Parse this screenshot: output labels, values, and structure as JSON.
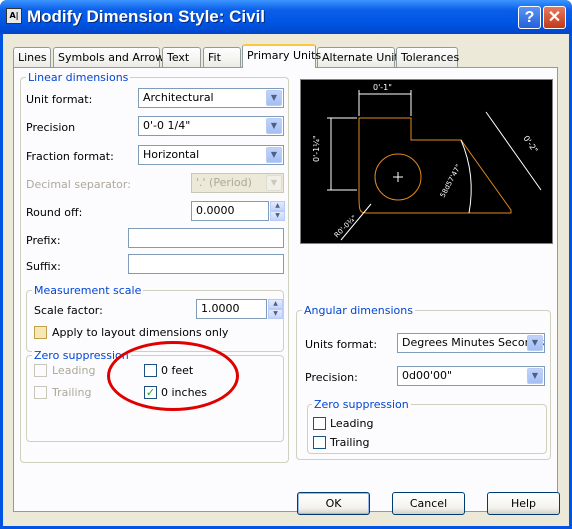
{
  "window": {
    "title": "Modify Dimension Style: Civil",
    "help_glyph": "?",
    "close_glyph": "✕",
    "icon_text": "A|"
  },
  "tabs": [
    "Lines",
    "Symbols and Arrows",
    "Text",
    "Fit",
    "Primary Units",
    "Alternate Units",
    "Tolerances"
  ],
  "active_tab": "Primary Units",
  "linear": {
    "group_label": "Linear dimensions",
    "unit_format_label": "Unit format:",
    "unit_format_value": "Architectural",
    "precision_label": "Precision",
    "precision_value": "0'-0 1/4\"",
    "fraction_label": "Fraction format:",
    "fraction_value": "Horizontal",
    "decimal_label": "Decimal separator:",
    "decimal_value": "'.' (Period)",
    "round_label": "Round off:",
    "round_value": "0.0000",
    "prefix_label": "Prefix:",
    "prefix_value": "",
    "suffix_label": "Suffix:",
    "suffix_value": ""
  },
  "measurement": {
    "group_label": "Measurement scale",
    "scale_label": "Scale factor:",
    "scale_value": "1.0000",
    "apply_label": "Apply to layout dimensions only",
    "apply_checked": false
  },
  "zero_linear": {
    "group_label": "Zero suppression",
    "leading": "Leading",
    "trailing": "Trailing",
    "feet": "0 feet",
    "inches": "0 inches",
    "feet_checked": false,
    "inches_checked": true
  },
  "angular": {
    "group_label": "Angular dimensions",
    "units_label": "Units format:",
    "units_value": "Degrees Minutes Seconds",
    "precision_label": "Precision:",
    "precision_value": "0d00'00\""
  },
  "zero_angular": {
    "group_label": "Zero suppression",
    "leading": "Leading",
    "trailing": "Trailing"
  },
  "preview": {
    "dim_top": "0'-1\"",
    "dim_left": "0'-1¼\"",
    "dim_right": "0'-2\"",
    "dim_angle": "58d57'47\"",
    "dim_radius": "R0'-0¾\"",
    "line_color": "#ffffff",
    "shape_color": "#e08a1e",
    "dim_color": "#ffffff"
  },
  "buttons": {
    "ok": "OK",
    "cancel": "Cancel",
    "help": "Help"
  },
  "colors": {
    "title_bar": "#0054e3",
    "annotation_circle": "#e00000",
    "group_label": "#0046d5"
  }
}
